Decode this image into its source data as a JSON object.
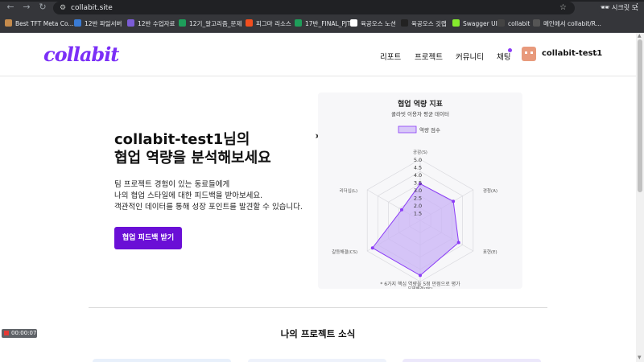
{
  "browser": {
    "url": "collabit.site",
    "incognito_label": "시크릿 모드",
    "bookmarks": [
      {
        "label": "Best TFT Meta Co...",
        "color": "#c58b4c"
      },
      {
        "label": "12반 파일서버",
        "color": "#3a7bd5"
      },
      {
        "label": "12반 수업자료",
        "color": "#7b5cd6"
      },
      {
        "label": "12기_알고리즘_문제",
        "color": "#1e9e5a"
      },
      {
        "label": "피그마 리소스",
        "color": "#f24e1e"
      },
      {
        "label": "17반_FINAL_PJT",
        "color": "#1e9e5a"
      },
      {
        "label": "육공오스 노션",
        "color": "#ffffff"
      },
      {
        "label": "육공오스 깃랩",
        "color": "#222222"
      },
      {
        "label": "Swagger UI",
        "color": "#85ea2d"
      },
      {
        "label": "collabit",
        "color": "#444444"
      },
      {
        "label": "메인에서 collabit/R...",
        "color": "#555555"
      }
    ]
  },
  "header": {
    "logo": "collabit",
    "nav": [
      "리포트",
      "프로젝트",
      "커뮤니티",
      "채팅"
    ],
    "user_name": "collabit-test1"
  },
  "hero": {
    "title_line1": "collabit-test1님의",
    "title_line2": "협업 역량을 분석해보세요",
    "body_line1": "팀 프로젝트 경험이 있는 동료들에게",
    "body_line2": "나의 협업 스타일에 대한 피드백을 받아보세요.",
    "body_line3": "객관적인 데이터를 통해 성장 포인트를 발견할 수 있습니다.",
    "cta": "협업 피드백 받기"
  },
  "chart_data": {
    "type": "radar",
    "title": "협업 역량 지표",
    "subtitle": "콜라빗 이용자 평균 데이터",
    "legend": "역량 점수",
    "axes": [
      "공감(S)",
      "경청(A)",
      "표현(E)",
      "문제해결(PS)",
      "갈등해결(CS)",
      "리더십(L)"
    ],
    "values": [
      3.4,
      3.5,
      3.9,
      4.6,
      4.6,
      2.4
    ],
    "ticks": [
      "1.5",
      "2.0",
      "2.5",
      "3.0",
      "3.5",
      "4.0",
      "4.5",
      "5.0"
    ],
    "range": [
      1,
      5
    ],
    "footnote": "* 6가지 핵심 역량을 5점 만점으로 평가",
    "color": "#8b3cf7",
    "fill": "#c9b3f5"
  },
  "section": {
    "title": "나의 프로젝트 소식"
  },
  "recorder": {
    "time": "00:00:07"
  }
}
